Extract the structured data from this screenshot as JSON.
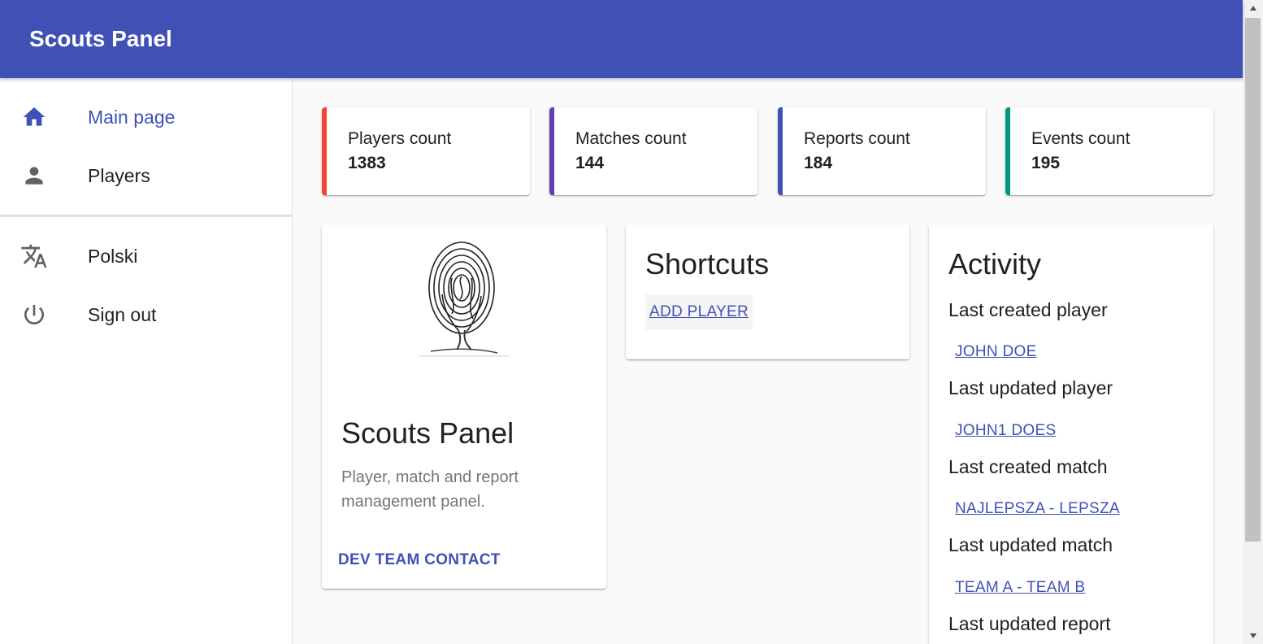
{
  "app": {
    "title": "Scouts Panel"
  },
  "sidebar": {
    "items": [
      {
        "label": "Main page",
        "icon": "home-icon"
      },
      {
        "label": "Players",
        "icon": "person-icon"
      },
      {
        "label": "Polski",
        "icon": "translate-icon"
      },
      {
        "label": "Sign out",
        "icon": "power-icon"
      }
    ]
  },
  "stats": [
    {
      "label": "Players count",
      "value": "1383",
      "color": "#f44336"
    },
    {
      "label": "Matches count",
      "value": "144",
      "color": "#673ab7"
    },
    {
      "label": "Reports count",
      "value": "184",
      "color": "#3f51b5"
    },
    {
      "label": "Events count",
      "value": "195",
      "color": "#009688"
    }
  ],
  "about": {
    "title": "Scouts Panel",
    "description": "Player, match and report management panel.",
    "contact_label": "DEV TEAM CONTACT"
  },
  "shortcuts": {
    "title": "Shortcuts",
    "add_player_label": "ADD PLAYER"
  },
  "activity": {
    "title": "Activity",
    "entries": [
      {
        "label": "Last created player",
        "link": "JOHN DOE"
      },
      {
        "label": "Last updated player",
        "link": "JOHN1 DOES"
      },
      {
        "label": "Last created match",
        "link": "NAJLEPSZA - LEPSZA"
      },
      {
        "label": "Last updated match",
        "link": "TEAM A - TEAM B"
      },
      {
        "label": "Last updated report",
        "link": ""
      }
    ]
  },
  "colors": {
    "primary": "#3f51b5",
    "icon": "#616161"
  }
}
